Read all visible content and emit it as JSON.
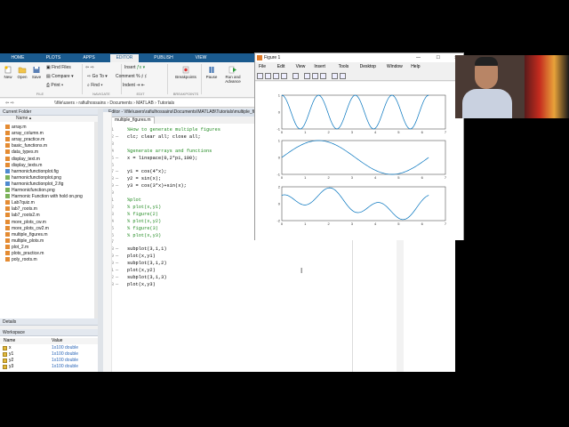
{
  "ribbon_tabs": [
    "HOME",
    "PLOTS",
    "APPS",
    "EDITOR",
    "PUBLISH",
    "VIEW"
  ],
  "ribbon": {
    "new_label": "New",
    "open_label": "Open",
    "save_label": "Save",
    "find_files": "Find Files",
    "compare": "Compare",
    "print": "Print",
    "go_to": "Go To",
    "find": "Find",
    "insert": "Insert",
    "comment": "Comment",
    "indent": "Indent",
    "breakpoints": "Breakpoints",
    "pause": "Pause",
    "run_advance": "Run and Advance",
    "sec_file": "FILE",
    "sec_navigate": "NAVIGATE",
    "sec_edit": "EDIT",
    "sec_breakpoints": "BREAKPOINTS"
  },
  "address_bar": "\\\\file\\users › rafiulhossains › Documents › MATLAB › Tutorials",
  "current_folder": {
    "title": "Current Folder",
    "column": "Name",
    "files": [
      "array.m",
      "array_column.m",
      "array_practice.m",
      "basic_functions.m",
      "data_types.m",
      "display_text.m",
      "display_texts.m",
      "harmonicfunctionplot.fig",
      "harmonicfunctionplot.png",
      "harmonicfunctionplot_2.fig",
      "Harmonicfunction.png",
      "Harmonic Function with hold on.png",
      "Lab7quiz.m",
      "lab7_roots.m",
      "lab7_roots2.m",
      "more_plots_cw.m",
      "more_plots_cw2.m",
      "multiple_figures.m",
      "multiple_plots.m",
      "plot_2.m",
      "plots_practice.m",
      "poly_roots.m"
    ]
  },
  "details_label": "Details",
  "workspace": {
    "title": "Workspace",
    "col_name": "Name",
    "col_value": "Value",
    "vars": [
      {
        "name": "x",
        "value": "1x100 double"
      },
      {
        "name": "y1",
        "value": "1x100 double"
      },
      {
        "name": "y2",
        "value": "1x100 double"
      },
      {
        "name": "y3",
        "value": "1x100 double"
      }
    ]
  },
  "editor": {
    "title": "Editor - \\\\file\\users\\rafiulhossains\\Documents\\MATLAB\\Tutorials\\multiple_figures.m",
    "tab": "multiple_figures.m",
    "lines": [
      {
        "n": "1",
        "dash": "",
        "text": "%How to generate multiple figures",
        "comment": true
      },
      {
        "n": "2",
        "dash": "—",
        "text": "clc; clear all; close all;",
        "comment": false
      },
      {
        "n": "3",
        "dash": "",
        "text": "",
        "comment": false
      },
      {
        "n": "4",
        "dash": "",
        "text": "%generate arrays and functions",
        "comment": true
      },
      {
        "n": "5",
        "dash": "—",
        "text": "x = linspace(0,2*pi,100);",
        "comment": false
      },
      {
        "n": "6",
        "dash": "",
        "text": "",
        "comment": false
      },
      {
        "n": "7",
        "dash": "—",
        "text": "y1 = cos(4*x);",
        "comment": false
      },
      {
        "n": "8",
        "dash": "—",
        "text": "y2 = sin(x);",
        "comment": false
      },
      {
        "n": "9",
        "dash": "—",
        "text": "y3 = cos(3*x)+sin(x);",
        "comment": false
      },
      {
        "n": "10",
        "dash": "",
        "text": "",
        "comment": false
      },
      {
        "n": "11",
        "dash": "",
        "text": "%plot",
        "comment": true
      },
      {
        "n": "12",
        "dash": "",
        "text": "% plot(x,y1)",
        "comment": true
      },
      {
        "n": "13",
        "dash": "",
        "text": "% figure(2)",
        "comment": true
      },
      {
        "n": "14",
        "dash": "",
        "text": "% plot(x,y2)",
        "comment": true
      },
      {
        "n": "15",
        "dash": "",
        "text": "% figure(3)",
        "comment": true
      },
      {
        "n": "16",
        "dash": "",
        "text": "% plot(x,y3)",
        "comment": true
      },
      {
        "n": "17",
        "dash": "",
        "text": "",
        "comment": false
      },
      {
        "n": "18",
        "dash": "—",
        "text": "subplot(3,1,1)",
        "comment": false
      },
      {
        "n": "19",
        "dash": "—",
        "text": "plot(x,y1)",
        "comment": false
      },
      {
        "n": "20",
        "dash": "—",
        "text": "subplot(3,1,2)",
        "comment": false
      },
      {
        "n": "21",
        "dash": "—",
        "text": "plot(x,y2)",
        "comment": false
      },
      {
        "n": "22",
        "dash": "—",
        "text": "subplot(3,1,3)",
        "comment": false
      },
      {
        "n": "23",
        "dash": "—",
        "text": "plot(x,y3)",
        "comment": false
      }
    ]
  },
  "figure": {
    "title": "Figure 1",
    "menu": [
      "File",
      "Edit",
      "View",
      "Insert",
      "Tools",
      "Desktop",
      "Window",
      "Help"
    ]
  },
  "chart_data": [
    {
      "type": "line",
      "function": "cos(4*x)",
      "xlim": [
        0,
        7
      ],
      "ylim": [
        -1,
        1
      ],
      "xticks": [
        0,
        1,
        2,
        3,
        4,
        5,
        6,
        7
      ],
      "yticks": [
        -1,
        0,
        1
      ],
      "color": "#0072bd"
    },
    {
      "type": "line",
      "function": "sin(x)",
      "xlim": [
        0,
        7
      ],
      "ylim": [
        -1,
        1
      ],
      "xticks": [
        0,
        1,
        2,
        3,
        4,
        5,
        6,
        7
      ],
      "yticks": [
        -1,
        0,
        1
      ],
      "color": "#0072bd"
    },
    {
      "type": "line",
      "function": "cos(3*x)+sin(x)",
      "xlim": [
        0,
        7
      ],
      "ylim": [
        -2,
        2
      ],
      "xticks": [
        0,
        1,
        2,
        3,
        4,
        5,
        6,
        7
      ],
      "yticks": [
        -2,
        0,
        2
      ],
      "color": "#0072bd"
    }
  ]
}
